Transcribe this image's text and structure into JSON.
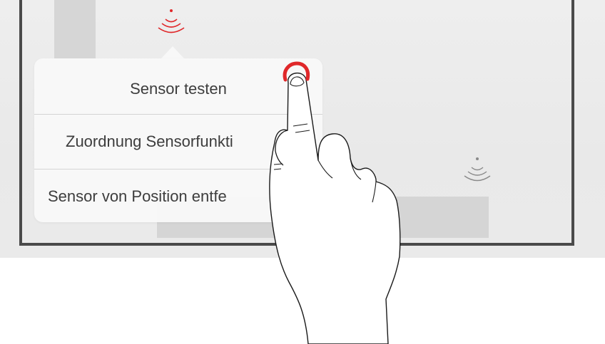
{
  "context_menu": {
    "items": [
      {
        "label": "Sensor testen"
      },
      {
        "label": "Zuordnung Sensorfunkti"
      },
      {
        "label": "Sensor von Position entfe"
      }
    ]
  },
  "icons": {
    "sensor_active": "wireless-sensor-icon",
    "sensor_inactive": "wireless-sensor-icon",
    "hand": "pointing-hand-icon",
    "tap": "tap-indicator-icon"
  },
  "colors": {
    "accent": "#e0282a",
    "menu_text": "#3d3d3d",
    "frame": "#4a4a4a",
    "background": "#eeeeee"
  }
}
